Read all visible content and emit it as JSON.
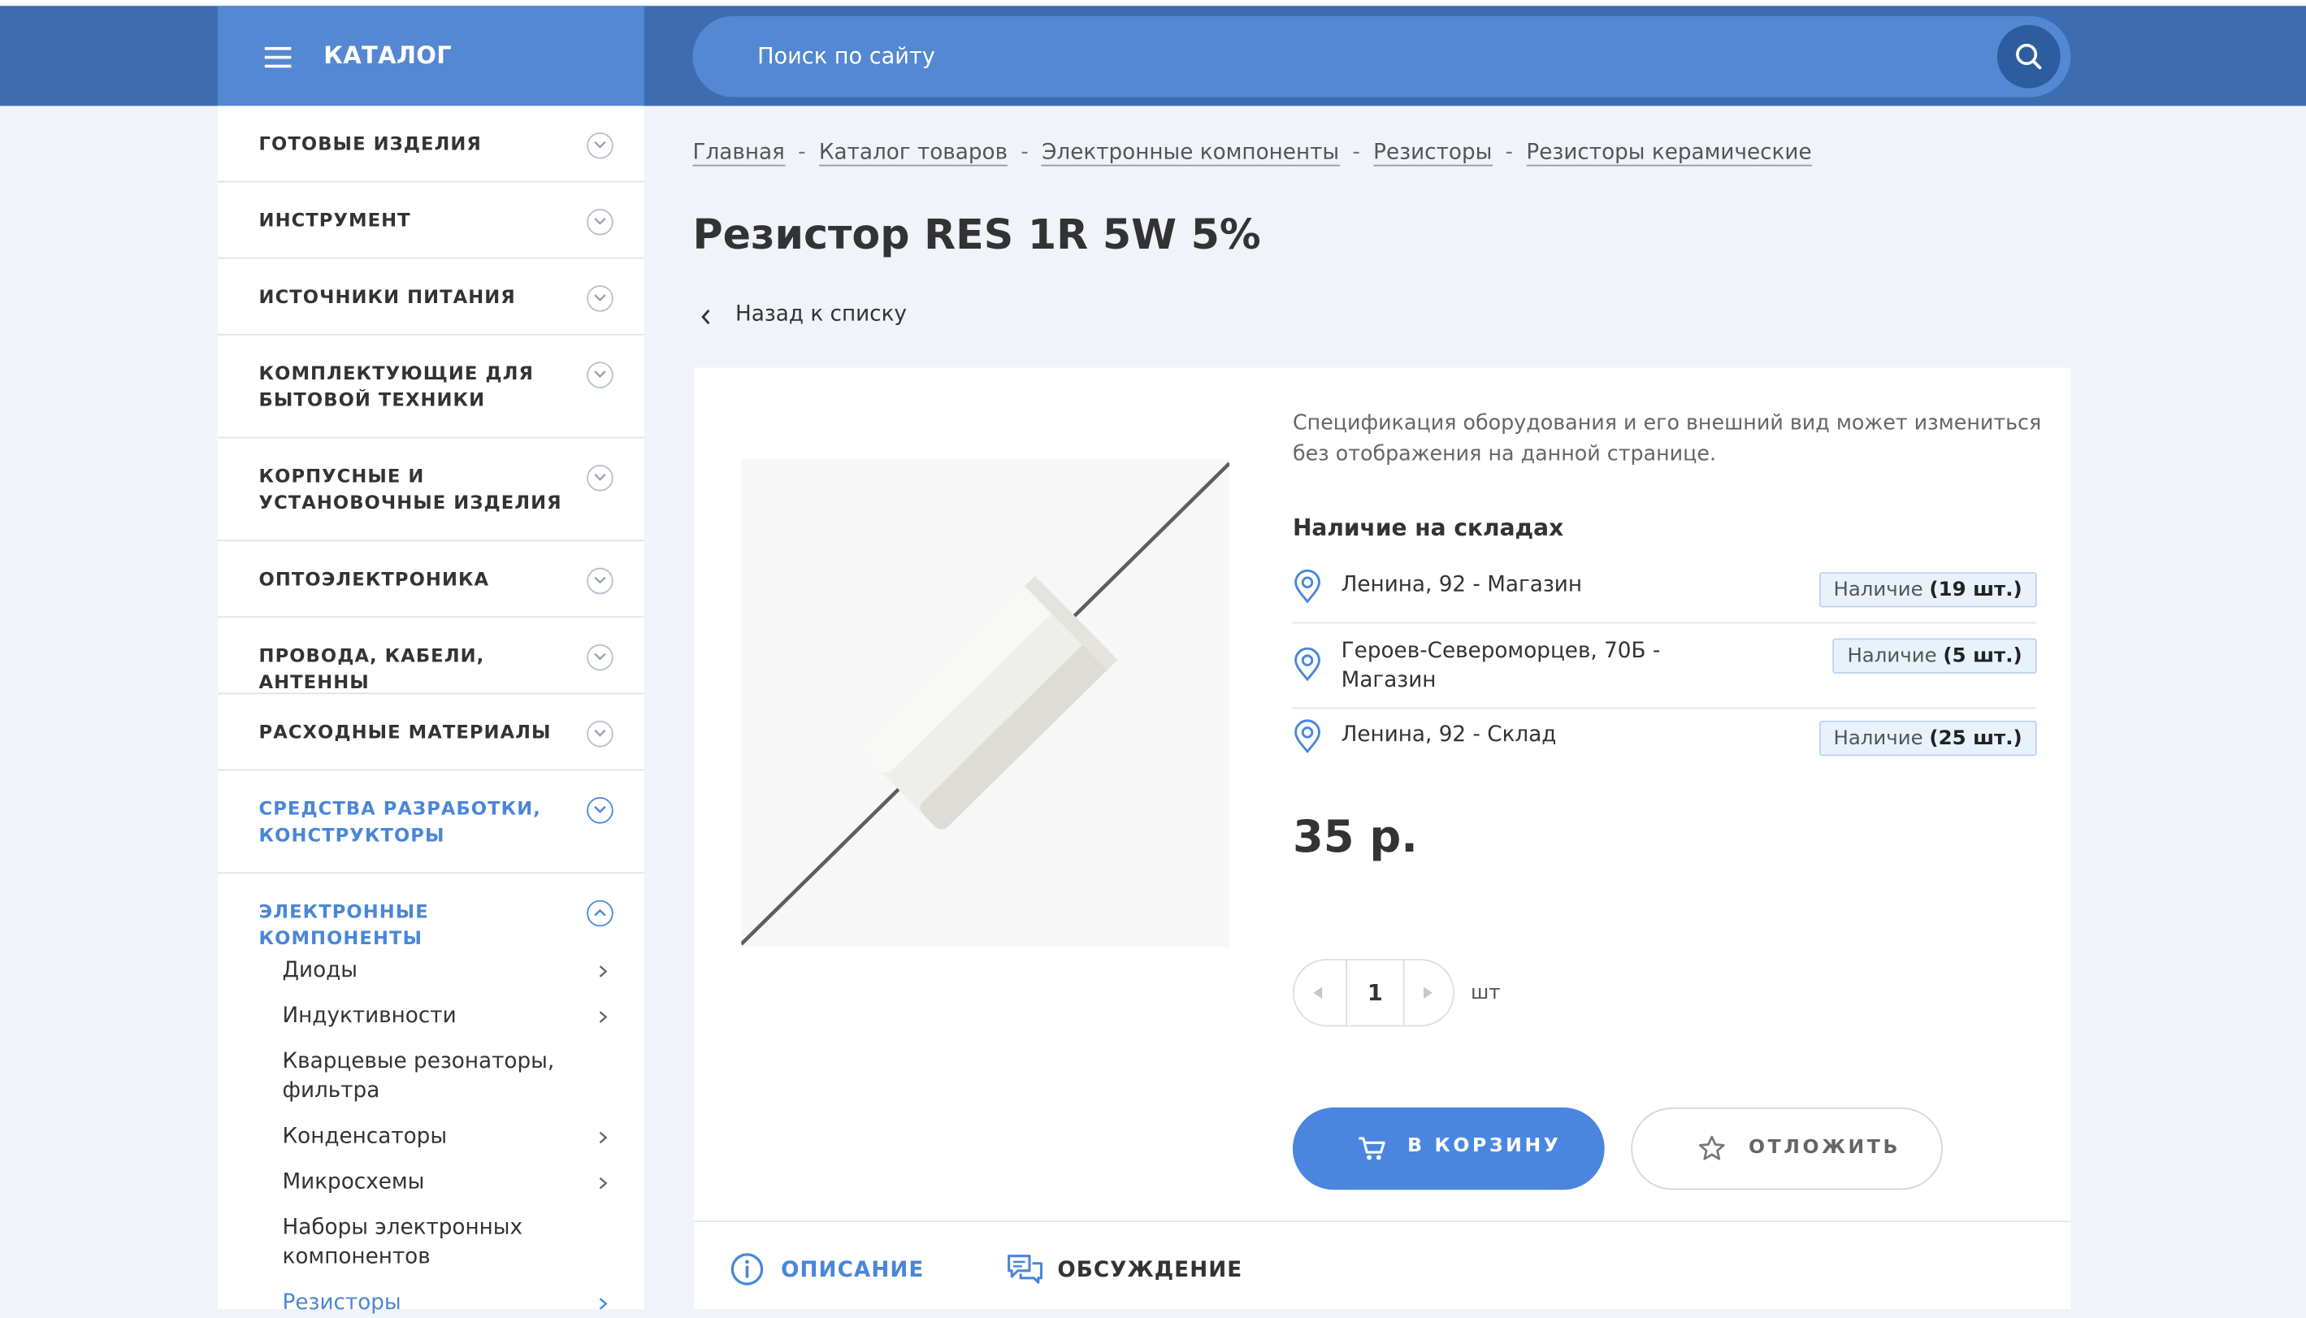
{
  "header": {
    "catalog_label": "КАТАЛОГ",
    "search_placeholder": "Поиск по сайту"
  },
  "sidebar": {
    "categories": [
      {
        "label": "ГОТОВЫЕ ИЗДЕЛИЯ",
        "expanded": false
      },
      {
        "label": "ИНСТРУМЕНТ",
        "expanded": false
      },
      {
        "label": "ИСТОЧНИКИ ПИТАНИЯ",
        "expanded": false
      },
      {
        "label": "КОМПЛЕКТУЮЩИЕ ДЛЯ БЫТОВОЙ ТЕХНИКИ",
        "expanded": false
      },
      {
        "label": "КОРПУСНЫЕ И УСТАНОВОЧНЫЕ ИЗДЕЛИЯ",
        "expanded": false
      },
      {
        "label": "ОПТОЭЛЕКТРОНИКА",
        "expanded": false
      },
      {
        "label": "ПРОВОДА, КАБЕЛИ, АНТЕННЫ",
        "expanded": false
      },
      {
        "label": "РАСХОДНЫЕ МАТЕРИАЛЫ",
        "expanded": false
      },
      {
        "label": "СРЕДСТВА РАЗРАБОТКИ, КОНСТРУКТОРЫ",
        "expanded": false
      },
      {
        "label": "ЭЛЕКТРОННЫЕ КОМПОНЕНТЫ",
        "expanded": true
      }
    ],
    "subitems": [
      {
        "label": "Диоды",
        "has_children": true
      },
      {
        "label": "Индуктивности",
        "has_children": true
      },
      {
        "label": "Кварцевые резонаторы, фильтра",
        "has_children": false
      },
      {
        "label": "Конденсаторы",
        "has_children": true
      },
      {
        "label": "Микросхемы",
        "has_children": true
      },
      {
        "label": "Наборы электронных компонентов",
        "has_children": false
      },
      {
        "label": "Резисторы",
        "has_children": true
      }
    ]
  },
  "breadcrumb": {
    "items": [
      "Главная",
      "Каталог товаров",
      "Электронные компоненты",
      "Резисторы",
      "Резисторы керамические"
    ],
    "separator": "-"
  },
  "product": {
    "title": "Резистор RES 1R 5W 5%",
    "back_label": "Назад к списку",
    "spec_note": "Спецификация оборудования и его внешний вид может измениться без отображения на данной странице.",
    "stock_title": "Наличие на складах",
    "stock": [
      {
        "address": "Ленина, 92 - Магазин",
        "status": "Наличие",
        "qty": "(19 шт.)"
      },
      {
        "address": "Героев-Североморцев, 70Б - Магазин",
        "status": "Наличие",
        "qty": "(5 шт.)"
      },
      {
        "address": "Ленина, 92 - Склад",
        "status": "Наличие",
        "qty": "(25 шт.)"
      }
    ],
    "price": "35 р.",
    "quantity": "1",
    "unit": "шт",
    "cart_label": "В КОРЗИНУ",
    "save_label": "ОТЛОЖИТЬ"
  },
  "tabs": [
    {
      "label": "ОПИСАНИЕ",
      "active": true
    },
    {
      "label": "ОБСУЖДЕНИЕ",
      "active": false
    }
  ],
  "colors": {
    "header_bg": "#3e6cb0",
    "catalog_bg": "#5488d2",
    "accent": "#4a86e0",
    "active_text": "#4a86d8"
  }
}
